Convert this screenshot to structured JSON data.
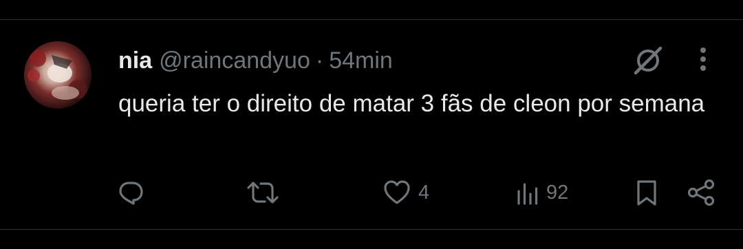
{
  "tweet": {
    "author_name": "nia",
    "author_handle": "@raincandyuo",
    "separator": "·",
    "time": "54min",
    "text": "queria ter o direito de matar 3 fãs de cleon por semana"
  },
  "actions": {
    "reply": {
      "icon": "reply-icon"
    },
    "retweet": {
      "icon": "retweet-icon"
    },
    "like": {
      "icon": "heart-icon",
      "count": "4"
    },
    "views": {
      "icon": "views-icon",
      "count": "92"
    },
    "bookmark": {
      "icon": "bookmark-icon"
    },
    "share": {
      "icon": "share-icon"
    }
  },
  "header_icons": {
    "grok": "grok-icon",
    "more": "more-icon"
  },
  "colors": {
    "background": "#000000",
    "text_primary": "#e7e9ea",
    "text_secondary": "#71767b",
    "divider": "#2f3336"
  }
}
